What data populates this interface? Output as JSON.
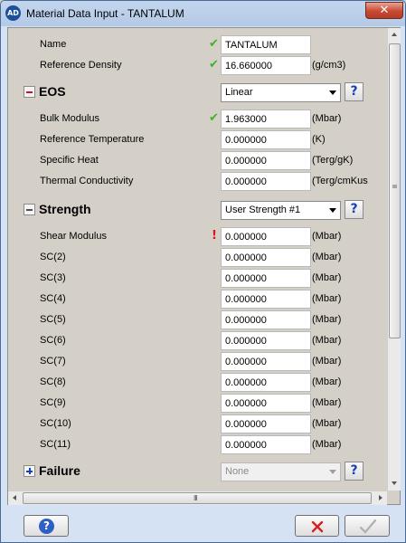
{
  "window": {
    "title": "Material Data Input - TANTALUM",
    "app_icon_text": "AD",
    "close_glyph": "✕"
  },
  "colors": {
    "ok": "#3fb02c",
    "error": "#e11414",
    "collapse": "#c8102e",
    "expand": "#1a3fb0",
    "help": "#1a3fb0"
  },
  "top_fields": [
    {
      "label": "Name",
      "status": "ok",
      "value": "TANTALUM",
      "unit": ""
    },
    {
      "label": "Reference Density",
      "status": "ok",
      "value": "16.660000",
      "unit": "(g/cm3)"
    }
  ],
  "sections": {
    "eos": {
      "title": "EOS",
      "toggle": "collapse",
      "selected": "Linear",
      "fields": [
        {
          "label": "Bulk Modulus",
          "status": "ok",
          "value": "1.963000",
          "unit": "(Mbar)"
        },
        {
          "label": "Reference Temperature",
          "status": "",
          "value": "0.000000",
          "unit": "(K)"
        },
        {
          "label": "Specific Heat",
          "status": "",
          "value": "0.000000",
          "unit": "(Terg/gK)"
        },
        {
          "label": "Thermal Conductivity",
          "status": "",
          "value": "0.000000",
          "unit": "(Terg/cmKus"
        }
      ]
    },
    "strength": {
      "title": "Strength",
      "toggle": "collapse-gray",
      "selected": "User Strength #1",
      "fields": [
        {
          "label": "Shear Modulus",
          "status": "error",
          "value": "0.000000",
          "unit": "(Mbar)"
        },
        {
          "label": "SC(2)",
          "status": "",
          "value": "0.000000",
          "unit": "(Mbar)"
        },
        {
          "label": "SC(3)",
          "status": "",
          "value": "0.000000",
          "unit": "(Mbar)"
        },
        {
          "label": "SC(4)",
          "status": "",
          "value": "0.000000",
          "unit": "(Mbar)"
        },
        {
          "label": "SC(5)",
          "status": "",
          "value": "0.000000",
          "unit": "(Mbar)"
        },
        {
          "label": "SC(6)",
          "status": "",
          "value": "0.000000",
          "unit": "(Mbar)"
        },
        {
          "label": "SC(7)",
          "status": "",
          "value": "0.000000",
          "unit": "(Mbar)"
        },
        {
          "label": "SC(8)",
          "status": "",
          "value": "0.000000",
          "unit": "(Mbar)"
        },
        {
          "label": "SC(9)",
          "status": "",
          "value": "0.000000",
          "unit": "(Mbar)"
        },
        {
          "label": "SC(10)",
          "status": "",
          "value": "0.000000",
          "unit": "(Mbar)"
        },
        {
          "label": "SC(11)",
          "status": "",
          "value": "0.000000",
          "unit": "(Mbar)"
        }
      ]
    },
    "failure": {
      "title": "Failure",
      "toggle": "expand",
      "selected": "None",
      "disabled": true
    }
  },
  "icons": {
    "ok": "check-icon",
    "error": "exclamation-icon",
    "help": "help-icon"
  },
  "footer": {
    "help_glyph": "?",
    "cancel_icon": "red-x-icon",
    "ok_icon": "checkmark-icon"
  },
  "hscroll_grip": "III"
}
